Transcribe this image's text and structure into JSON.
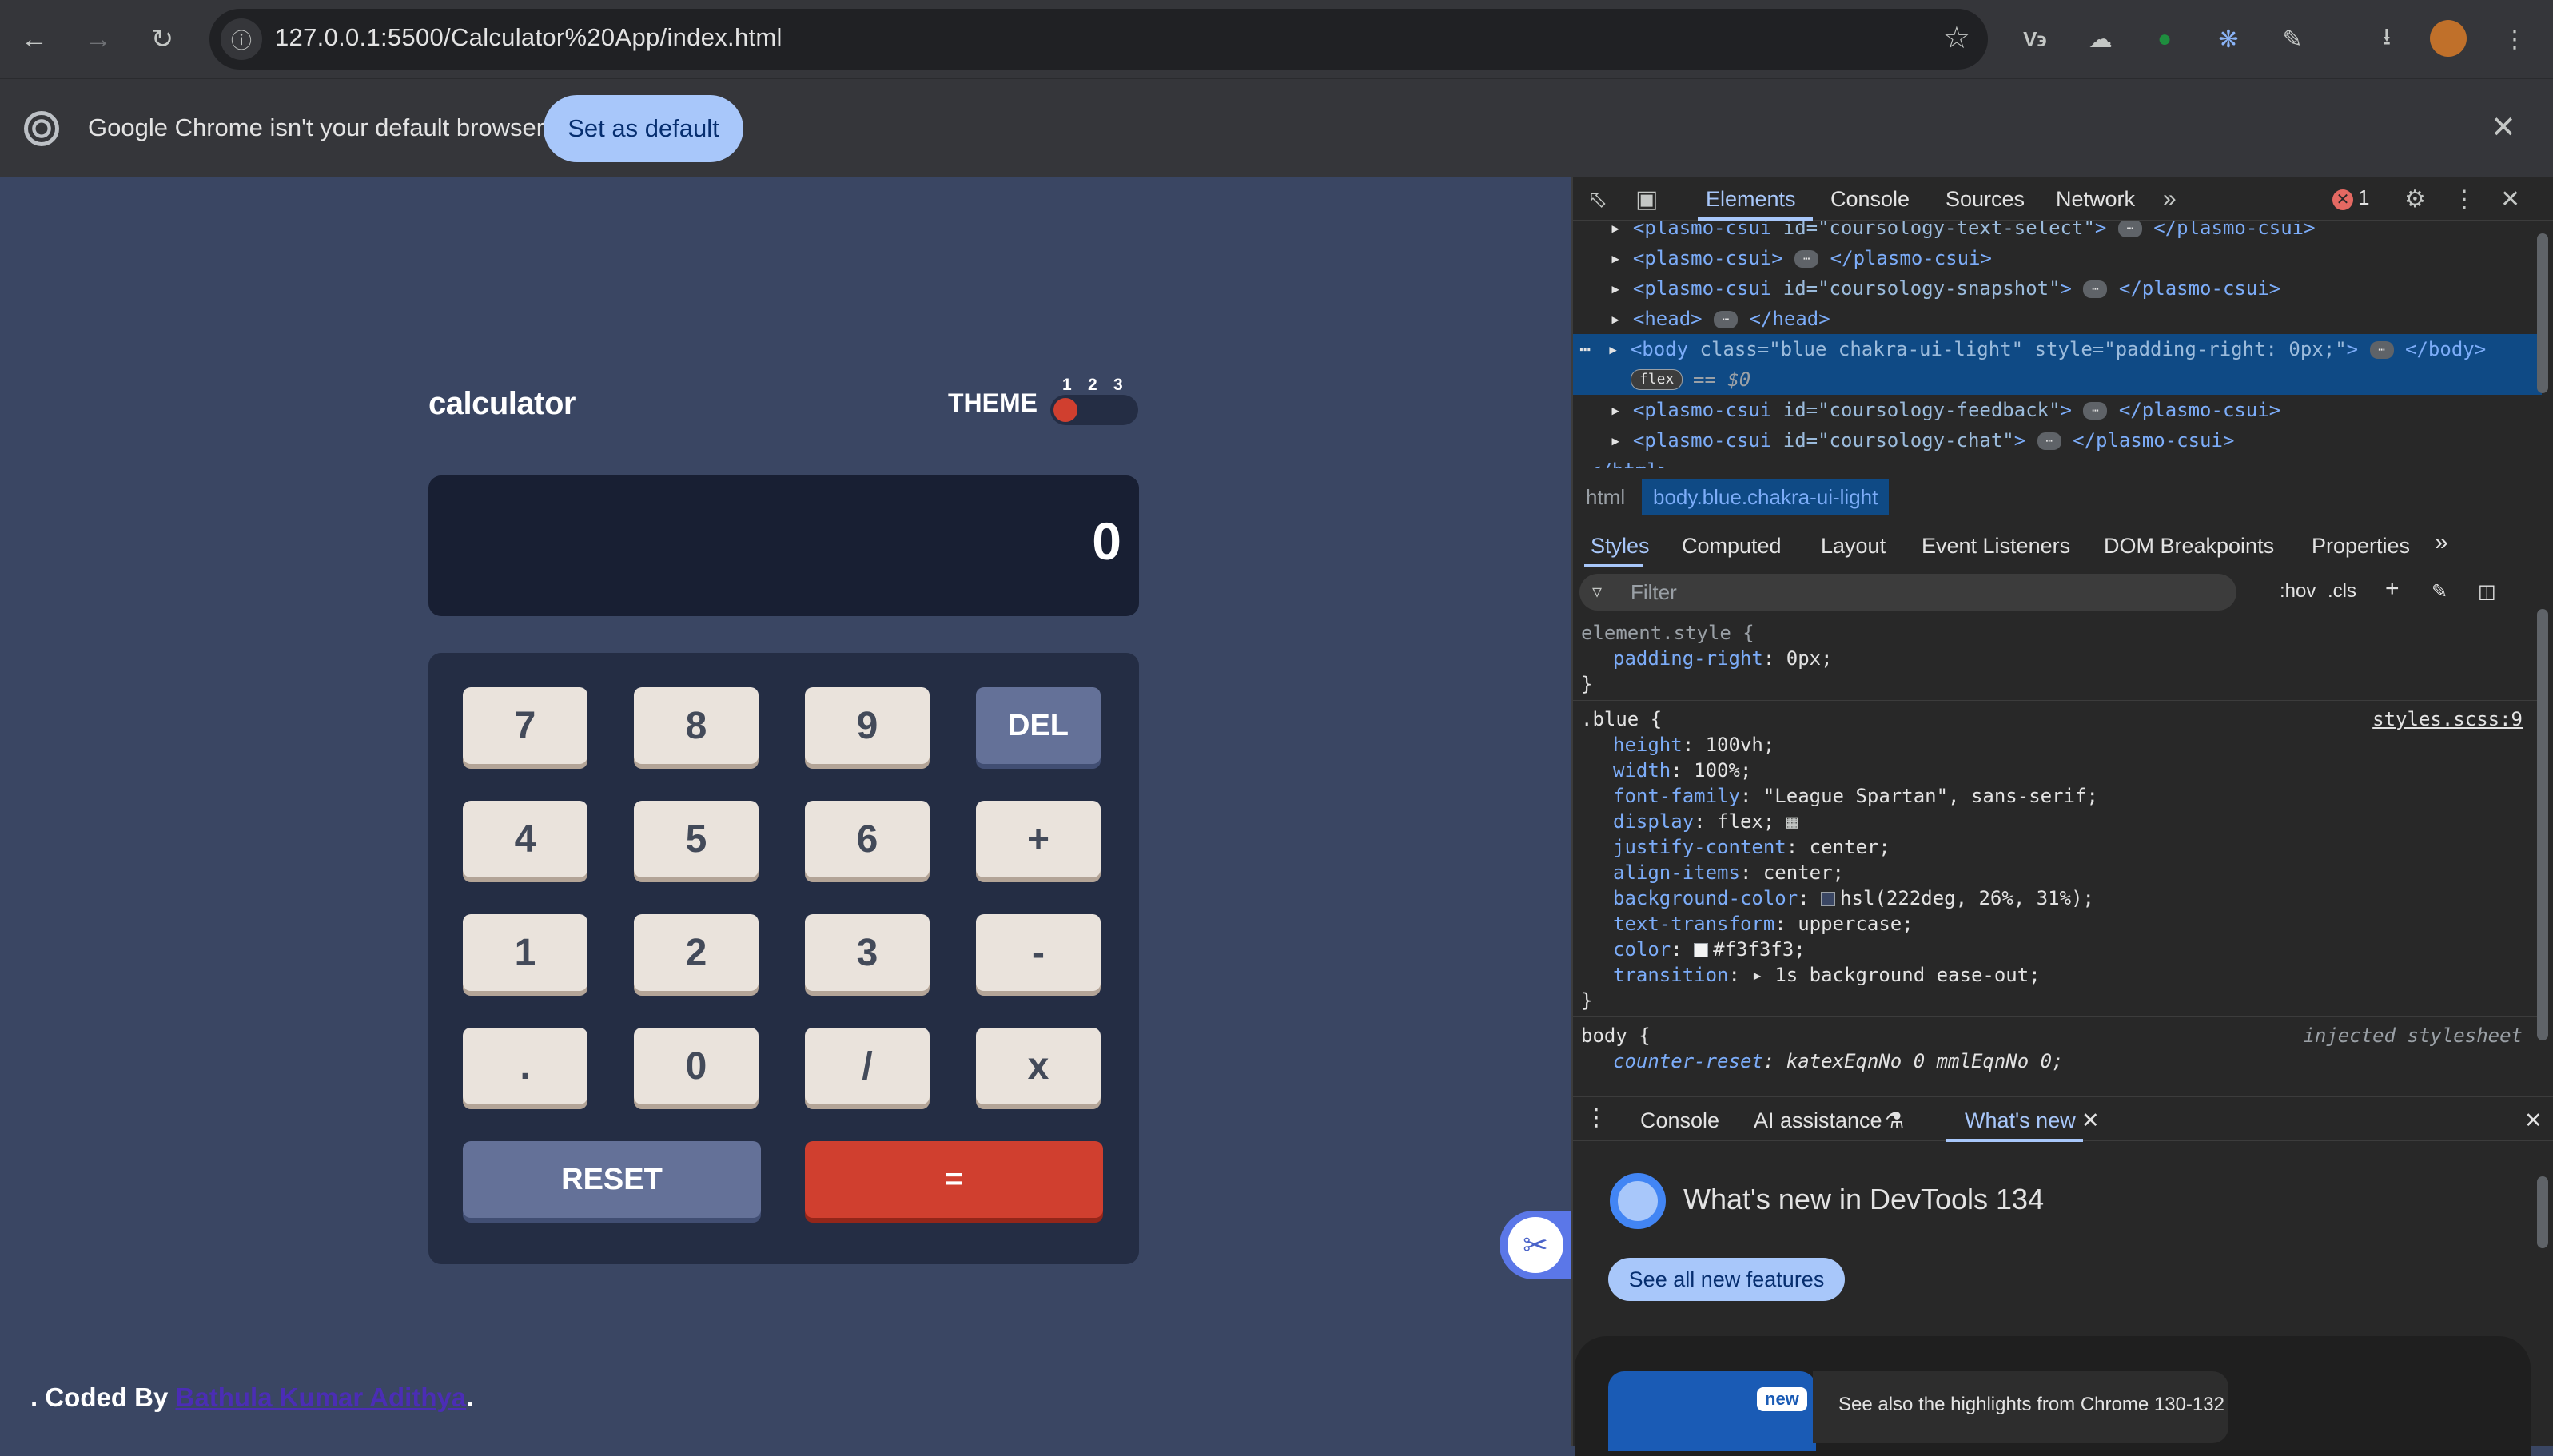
{
  "browser": {
    "url": "127.0.0.1:5500/Calculator%20App/index.html",
    "infobar_text": "Google Chrome isn't your default browser",
    "infobar_button": "Set as default",
    "ext_vb_label": "V϶"
  },
  "calculator": {
    "title": "calculator",
    "theme_label": "THEME",
    "theme_numbers": [
      "1",
      "2",
      "3"
    ],
    "display_value": "0",
    "keys": [
      "7",
      "8",
      "9",
      "DEL",
      "4",
      "5",
      "6",
      "+",
      "1",
      "2",
      "3",
      "-",
      ".",
      "0",
      "/",
      "x"
    ],
    "reset_label": "RESET",
    "equals_label": "=",
    "footer_prefix": ". Coded By ",
    "footer_link": "Bathula Kumar Adithya",
    "footer_suffix": ".",
    "colors": {
      "background": "#3a4663",
      "keypad": "#242d44",
      "screen": "#181f33",
      "accent_red": "#d03f2f",
      "key_light": "#eae3dc",
      "key_blue": "#647198"
    }
  },
  "devtools": {
    "tabs": [
      "Elements",
      "Console",
      "Sources",
      "Network"
    ],
    "error_count": "1",
    "tree": [
      {
        "tag": "plasmo-csui",
        "attrs": " id=\"coursology-text-select\"",
        "close": "</plasmo-csui>"
      },
      {
        "tag": "plasmo-csui",
        "attrs": "",
        "close": "</plasmo-csui>"
      },
      {
        "tag": "plasmo-csui",
        "attrs": " id=\"coursology-snapshot\"",
        "close": "</plasmo-csui>"
      },
      {
        "tag": "head",
        "attrs": "",
        "close": "</head>"
      },
      {
        "tag": "body",
        "attrs": " class=\"blue chakra-ui-light\" style=\"padding-right: 0px;\"",
        "close": "</body>"
      },
      {
        "tag": "plasmo-csui",
        "attrs": " id=\"coursology-feedback\"",
        "close": "</plasmo-csui>"
      },
      {
        "tag": "plasmo-csui",
        "attrs": " id=\"coursology-chat\"",
        "close": "</plasmo-csui>"
      }
    ],
    "flex_badge": "flex",
    "selected_marker": "== $0",
    "html_close": "</html>",
    "breadcrumb": [
      "html",
      "body.blue.chakra-ui-light"
    ],
    "styles_tabs": [
      "Styles",
      "Computed",
      "Layout",
      "Event Listeners",
      "DOM Breakpoints",
      "Properties"
    ],
    "filter_placeholder": "Filter",
    "hov": ":hov",
    "cls": ".cls",
    "rules": {
      "element_style": {
        "selector": "element.style {",
        "props": [
          [
            "padding-right",
            "0px;"
          ]
        ]
      },
      "blue": {
        "selector": ".blue {",
        "source": "styles.scss:9",
        "props": [
          [
            "height",
            "100vh;"
          ],
          [
            "width",
            "100%;"
          ],
          [
            "font-family",
            "\"League Spartan\", sans-serif;"
          ],
          [
            "display",
            "flex;"
          ],
          [
            "justify-content",
            "center;"
          ],
          [
            "align-items",
            "center;"
          ],
          [
            "background-color",
            "hsl(222deg, 26%, 31%);"
          ],
          [
            "text-transform",
            "uppercase;"
          ],
          [
            "color",
            "#f3f3f3;"
          ],
          [
            "transition",
            "1s background ease-out;"
          ]
        ]
      },
      "body": {
        "selector": "body {",
        "source": "injected stylesheet",
        "props": [
          [
            "counter-reset",
            "katexEqnNo 0 mmlEqnNo 0;"
          ]
        ]
      }
    },
    "drawer_tabs": [
      "Console",
      "AI assistance",
      "What's new"
    ],
    "whatsnew_title": "What's new in DevTools 134",
    "whatsnew_button": "See all new features",
    "whatsnew_badge": "new",
    "whatsnew_card": "See also the highlights from Chrome 130-132"
  }
}
